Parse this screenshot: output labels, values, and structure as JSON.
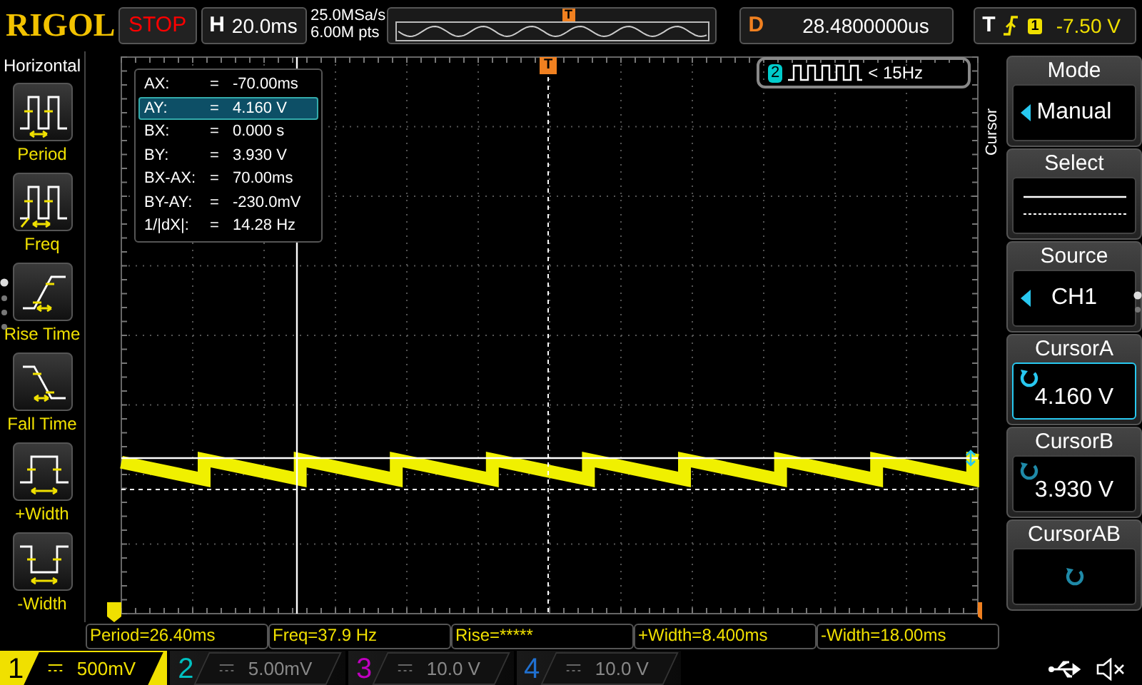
{
  "brand": "RIGOL",
  "run_state": "STOP",
  "timebase": {
    "label": "H",
    "value": "20.0ms"
  },
  "acquisition": {
    "sample_rate": "25.0MSa/s",
    "memory_depth": "6.00M pts"
  },
  "overview": {
    "marker": "T"
  },
  "delay": {
    "label": "D",
    "value": "28.4800000us"
  },
  "trigger": {
    "label": "T",
    "channel": "1",
    "level": "-7.50 V"
  },
  "left_panel": {
    "title": "Horizontal",
    "items": [
      {
        "kind": "period",
        "label": "Period"
      },
      {
        "kind": "freq",
        "label": "Freq"
      },
      {
        "kind": "rise",
        "label": "Rise Time"
      },
      {
        "kind": "fall",
        "label": "Fall Time"
      },
      {
        "kind": "pwidth",
        "label": "+Width"
      },
      {
        "kind": "nwidth",
        "label": "-Width"
      }
    ]
  },
  "screen": {
    "trigger_marker": "T",
    "readout": [
      {
        "label": "AX:",
        "eq": "=",
        "value": "-70.00ms",
        "selected": false
      },
      {
        "label": "AY:",
        "eq": "=",
        "value": "4.160 V",
        "selected": true
      },
      {
        "label": "BX:",
        "eq": "=",
        "value": "0.000 s",
        "selected": false
      },
      {
        "label": "BY:",
        "eq": "=",
        "value": "3.930 V",
        "selected": false
      },
      {
        "label": "BX-AX:",
        "eq": "=",
        "value": "70.00ms",
        "selected": false
      },
      {
        "label": "BY-AY:",
        "eq": "=",
        "value": "-230.0mV",
        "selected": false
      },
      {
        "label": "1/|dX|:",
        "eq": "=",
        "value": "14.28 Hz",
        "selected": false
      }
    ],
    "freq_badge": {
      "channel": "2",
      "text": "< 15Hz"
    }
  },
  "menu": {
    "title": "Cursor",
    "items": [
      {
        "kind": "select",
        "label": "Mode",
        "value": "Manual",
        "active": false
      },
      {
        "kind": "lines",
        "label": "Select",
        "active": false
      },
      {
        "kind": "select",
        "label": "Source",
        "value": "CH1",
        "active": false
      },
      {
        "kind": "knob",
        "label": "CursorA",
        "value": "4.160 V",
        "active": true
      },
      {
        "kind": "knob",
        "label": "CursorB",
        "value": "3.930 V",
        "active": false
      },
      {
        "kind": "knob",
        "label": "CursorAB",
        "active": false
      }
    ]
  },
  "measurements": [
    "Period=26.40ms",
    "Freq=37.9 Hz",
    "Rise=*****",
    "+Width=8.400ms",
    "-Width=18.00ms"
  ],
  "channels": [
    {
      "number": "1",
      "scale": "500mV",
      "on": true,
      "color": "#f0e000"
    },
    {
      "number": "2",
      "scale": "5.00mV",
      "on": false,
      "color": "#00c0c0"
    },
    {
      "number": "3",
      "scale": "10.0 V",
      "on": false,
      "color": "#c000c0"
    },
    {
      "number": "4",
      "scale": "10.0 V",
      "on": false,
      "color": "#2070d0"
    }
  ]
}
